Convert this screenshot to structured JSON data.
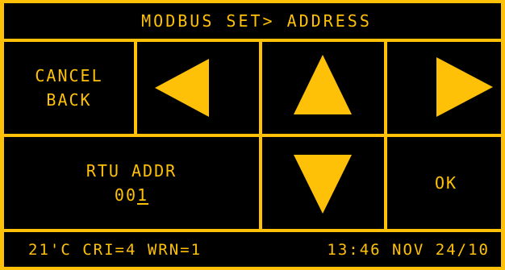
{
  "colors": {
    "accent": "#ffc107",
    "background": "#000000"
  },
  "header": {
    "title": "MODBUS SET> ADDRESS"
  },
  "buttons": {
    "cancel_line1": "CANCEL",
    "cancel_line2": "BACK",
    "left_icon": "triangle-left-icon",
    "up_icon": "triangle-up-icon",
    "down_icon": "triangle-down-icon",
    "right_icon": "triangle-right-icon",
    "ok_label": "OK"
  },
  "field": {
    "label": "RTU ADDR",
    "value_prefix": "00",
    "value_cursor": "1"
  },
  "status_bar": {
    "left": "21'C CRI=4 WRN=1",
    "right": "13:46 NOV 24/10"
  }
}
